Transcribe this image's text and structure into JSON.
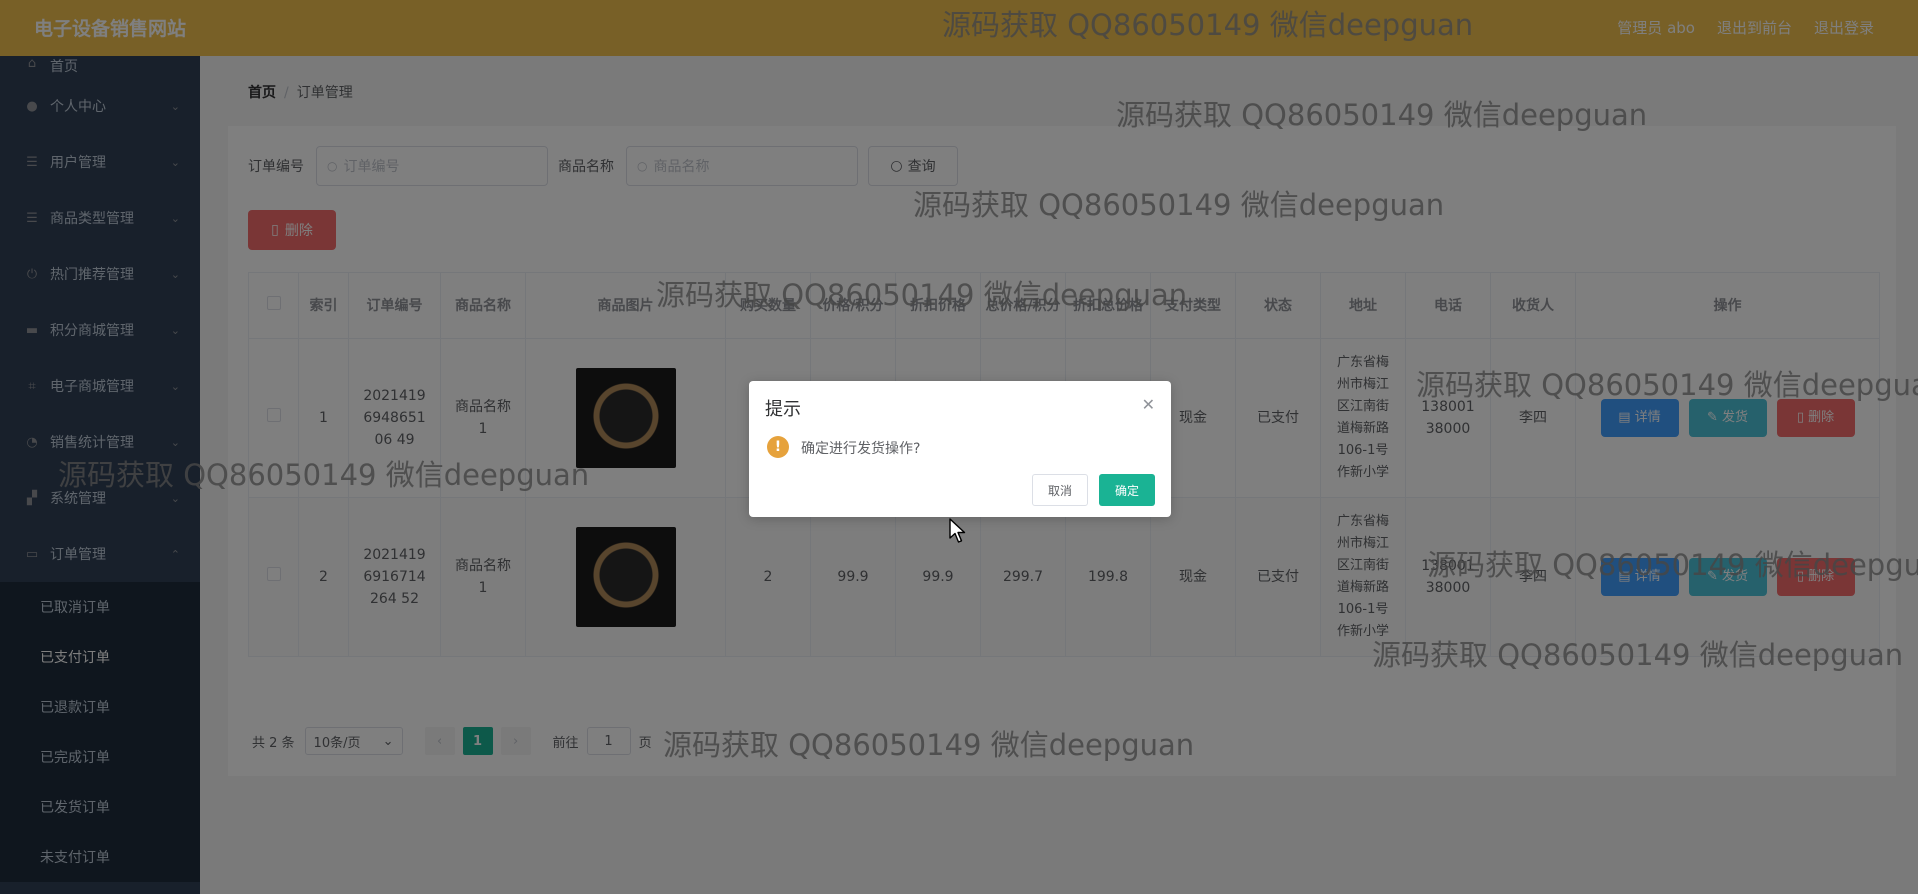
{
  "header": {
    "brand": "电子设备销售网站",
    "admin": "管理员 abo",
    "to_front": "退出到前台",
    "logout": "退出登录"
  },
  "sidebar": {
    "items": [
      {
        "label": "首页",
        "icon": "home-icon"
      },
      {
        "label": "个人中心",
        "icon": "user-icon"
      },
      {
        "label": "用户管理",
        "icon": "list-icon"
      },
      {
        "label": "商品类型管理",
        "icon": "list-icon"
      },
      {
        "label": "热门推荐管理",
        "icon": "power-icon"
      },
      {
        "label": "积分商城管理",
        "icon": "monitor-icon"
      },
      {
        "label": "电子商城管理",
        "icon": "crop-icon"
      },
      {
        "label": "销售统计管理",
        "icon": "chart-icon"
      },
      {
        "label": "系统管理",
        "icon": "settings-icon"
      },
      {
        "label": "订单管理",
        "icon": "chat-icon"
      }
    ],
    "sub_items": [
      "已取消订单",
      "已支付订单",
      "已退款订单",
      "已完成订单",
      "已发货订单",
      "未支付订单"
    ]
  },
  "breadcrumb": {
    "home": "首页",
    "sep": "/",
    "current": "订单管理"
  },
  "search": {
    "order_label": "订单编号",
    "order_placeholder": "订单编号",
    "name_label": "商品名称",
    "name_placeholder": "商品名称",
    "query_button": "查询"
  },
  "toolbar": {
    "delete_button": "删除"
  },
  "table": {
    "headers": [
      "索引",
      "订单编号",
      "商品名称",
      "商品图片",
      "购买数量",
      "价格/积分",
      "折扣价格",
      "总价格/积分",
      "折扣总价格",
      "支付类型",
      "状态",
      "地址",
      "电话",
      "收货人",
      "操作"
    ],
    "rows": [
      {
        "index": "1",
        "order_no": "2021419694865106 49",
        "name": "商品名称1",
        "qty": "",
        "price": "",
        "discount": "",
        "total": "",
        "discount_total": "",
        "pay": "现金",
        "status": "已支付",
        "address": "广东省梅州市梅江区江南街道梅新路106-1号作新小学",
        "phone": "13800138000",
        "receiver": "李四"
      },
      {
        "index": "2",
        "order_no": "20214196916714264 52",
        "name": "商品名称1",
        "qty": "2",
        "price": "99.9",
        "discount": "99.9",
        "total": "299.7",
        "discount_total": "199.8",
        "pay": "现金",
        "status": "已支付",
        "address": "广东省梅州市梅江区江南街道梅新路106-1号作新小学",
        "phone": "13800138000",
        "receiver": "李四"
      }
    ],
    "ops": {
      "detail": "详情",
      "ship": "发货",
      "delete": "删除"
    }
  },
  "pager": {
    "total": "共 2 条",
    "size": "10条/页",
    "page": "1",
    "goto_label": "前往",
    "goto_value": "1",
    "page_unit": "页"
  },
  "dialog": {
    "title": "提示",
    "message": "确定进行发货操作?",
    "cancel": "取消",
    "confirm": "确定"
  },
  "watermark": "源码获取 QQ86050149 微信deepguan"
}
